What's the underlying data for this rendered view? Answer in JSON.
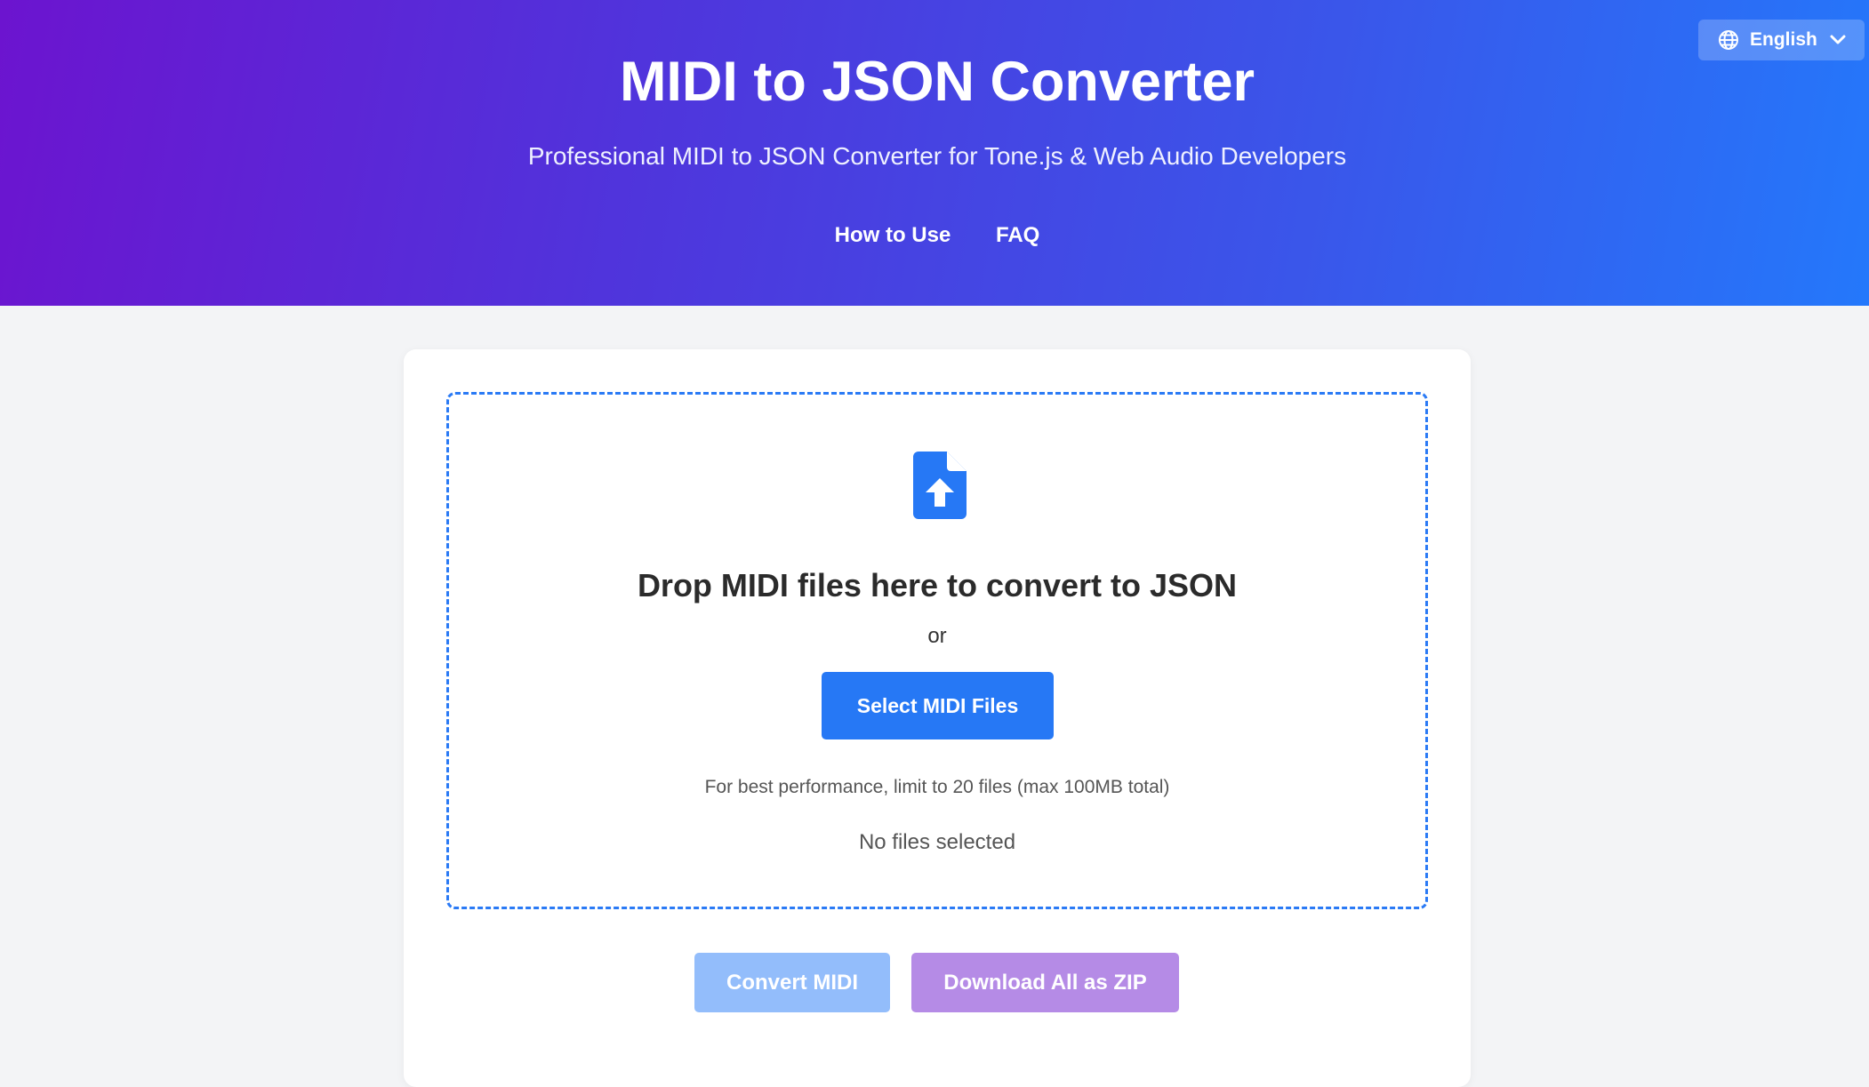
{
  "header": {
    "title": "MIDI to JSON Converter",
    "subtitle": "Professional MIDI to JSON Converter for Tone.js & Web Audio Developers",
    "nav": [
      {
        "label": "How to Use"
      },
      {
        "label": "FAQ"
      }
    ],
    "language": {
      "selected": "English",
      "icon": "globe-icon",
      "dropdown_icon": "chevron-down-icon"
    }
  },
  "dropzone": {
    "icon": "file-upload-icon",
    "title": "Drop MIDI files here to convert to JSON",
    "or_text": "or",
    "select_button": "Select MIDI Files",
    "limit_text": "For best performance, limit to 20 files (max 100MB total)",
    "status": "No files selected"
  },
  "actions": {
    "convert_label": "Convert MIDI",
    "convert_state": "disabled",
    "download_label": "Download All as ZIP",
    "download_state": "disabled"
  },
  "colors": {
    "header_gradient_start": "#6c14cf",
    "header_gradient_end": "#2478fb",
    "accent": "#2678f5",
    "convert_disabled": "#93bdfb",
    "download_disabled": "#b58be6",
    "page_background": "#f3f4f6"
  }
}
